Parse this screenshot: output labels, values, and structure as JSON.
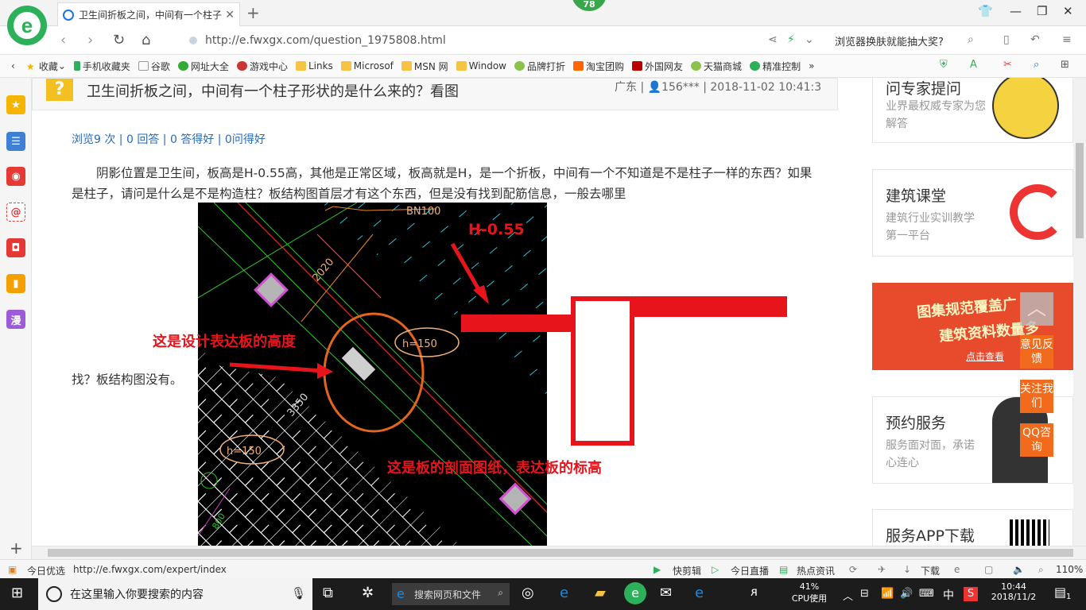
{
  "browser": {
    "tab_title": "卫生间折板之间，中间有一个柱子",
    "badge": "78",
    "url": "http://e.fwxgx.com/question_1975808.html",
    "search_hint": "浏览器换肤就能抽大奖?",
    "favorites": [
      "收藏",
      "手机收藏夹",
      "谷歌",
      "网址大全",
      "游戏中心",
      "Links",
      "Microsof",
      "MSN 网",
      "Window",
      "品牌打折",
      "淘宝团购",
      "外国网友",
      "天猫商城",
      "精准控制"
    ]
  },
  "question": {
    "title": "卫生间折板之间，中间有一个柱子形状的是什么来的？看图",
    "meta": "广东 | 👤156*** | 2018-11-02 10:41:3",
    "stats": "浏览9 次 | 0 回答 | 0 答得好 | 0问得好",
    "body": "阴影位置是卫生间，板高是H-0.55高，其他是正常区域，板高就是H，是一个折板，中间有一个不知道是不是柱子一样的东西？如果是柱子，请问是什么是不是构造柱？板结构图首层才有这个东西，但是没有找到配筋信息，一般去哪里",
    "body_tail": "找？板结构图没有。"
  },
  "image": {
    "label_bn": "BN100",
    "dim_2020": "2020",
    "dim_3350": "3350",
    "dim_800": "800",
    "h150_a": "h=150",
    "h150_b": "h=150",
    "h_label": "H-0.55",
    "annot_height": "这是设计表达板的高度",
    "annot_section": "这是板的剖面图纸，表达板的标高"
  },
  "right": {
    "card1_title": "问专家提问",
    "card1_text": "业界最权威专家为您解答",
    "card2_title": "建筑课堂",
    "card2_text": "建筑行业实训教学第一平台",
    "banner_line1": "图集规范覆盖广",
    "banner_line2": "建筑资料数量多",
    "banner_link": "点击查看",
    "card4_title": "预约服务",
    "card4_text": "服务面对面，承诺心连心",
    "card5_title": "服务APP下载",
    "btn_feedback": "意见反馈",
    "btn_follow": "关注我们",
    "btn_qq": "QQ咨询"
  },
  "statusbar": {
    "left1": "今日优选",
    "url": "http://e.fwxgx.com/expert/index",
    "quickcut": "快剪辑",
    "live": "今日直播",
    "news": "热点资讯",
    "download": "下载",
    "zoom": "110%"
  },
  "taskbar": {
    "search_placeholder": "在这里输入你要搜索的内容",
    "web_search": "搜索网页和文件",
    "cpu_percent": "41%",
    "cpu_label": "CPU使用",
    "ime": "中",
    "time": "10:44",
    "date": "2018/11/2",
    "notifications": "1"
  },
  "colors": {
    "accent_green": "#2db05a",
    "annotation_red": "#e8141c",
    "orange": "#f26a1b"
  }
}
